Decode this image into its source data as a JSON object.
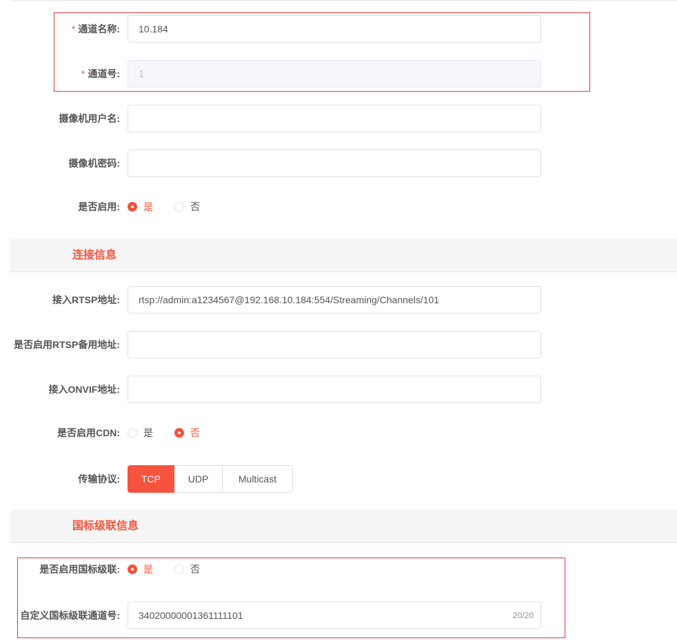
{
  "basic": {
    "channel_name": {
      "label": "通道名称:",
      "required_mark": "*",
      "value": "10.184"
    },
    "channel_no": {
      "label": "通道号:",
      "required_mark": "*",
      "value": "1"
    },
    "camera_user": {
      "label": "摄像机用户名:",
      "value": ""
    },
    "camera_password": {
      "label": "摄像机密码:",
      "value": ""
    },
    "enabled": {
      "label": "是否启用:",
      "options": [
        "是",
        "否"
      ],
      "selected": "是"
    }
  },
  "connection": {
    "title": "连接信息",
    "rtsp": {
      "label": "接入RTSP地址:",
      "value": "rtsp://admin:a1234567@192.168.10.184:554/Streaming/Channels/101"
    },
    "rtsp_backup": {
      "label": "是否启用RTSP备用地址:",
      "value": ""
    },
    "onvif": {
      "label": "接入ONVIF地址:",
      "value": ""
    },
    "cdn": {
      "label": "是否启用CDN:",
      "options": [
        "是",
        "否"
      ],
      "selected": "否"
    },
    "protocol": {
      "label": "传输协议:",
      "options": [
        "TCP",
        "UDP",
        "Multicast"
      ],
      "selected": "TCP"
    }
  },
  "gb_cascade": {
    "title": "国标级联信息",
    "enabled": {
      "label": "是否启用国标级联:",
      "options": [
        "是",
        "否"
      ],
      "selected": "是"
    },
    "custom_channel_no": {
      "label": "自定义国标级联通道号:",
      "value": "34020000001361111101",
      "counter": "20/20"
    }
  },
  "colors": {
    "accent": "#f5533d",
    "highlight_border": "#e0363a",
    "section_bg": "#f5f5f5"
  }
}
